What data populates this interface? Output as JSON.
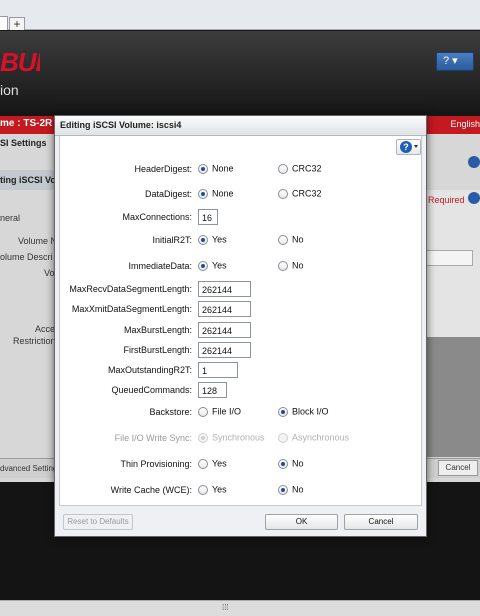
{
  "browser": {
    "new_tab_label": "+"
  },
  "background": {
    "logo_text": "BUFFALO",
    "app_subtitle": "ion",
    "help_button": "? ▾",
    "red_bar_title": "me : TS-2R",
    "red_bar_right": "English",
    "nav1": "SI Settings",
    "nav2": "ting iSCSI Volu",
    "labels": [
      "neral",
      "Volume N",
      "olume Descri",
      "Vo",
      "Acce",
      "Restriction"
    ],
    "required_text": "Required",
    "bottom_left": "dvanced Setting",
    "bottom_right": "Cancel"
  },
  "modal": {
    "title": "Editing iSCSI Volume: iscsi4",
    "fields": {
      "header_digest": {
        "label": "HeaderDigest:",
        "option1": "None",
        "option2": "CRC32"
      },
      "data_digest": {
        "label": "DataDigest:",
        "option1": "None",
        "option2": "CRC32"
      },
      "max_connections": {
        "label": "MaxConnections:",
        "value": "16"
      },
      "initial_r2t": {
        "label": "InitialR2T:",
        "option1": "Yes",
        "option2": "No"
      },
      "immediate_data": {
        "label": "ImmediateData:",
        "option1": "Yes",
        "option2": "No"
      },
      "max_recv": {
        "label": "MaxRecvDataSegmentLength:",
        "value": "262144"
      },
      "max_xmit": {
        "label": "MaxXmitDataSegmentLength:",
        "value": "262144"
      },
      "max_burst": {
        "label": "MaxBurstLength:",
        "value": "262144"
      },
      "first_burst": {
        "label": "FirstBurstLength:",
        "value": "262144"
      },
      "max_outstanding": {
        "label": "MaxOutstandingR2T:",
        "value": "1"
      },
      "queued_commands": {
        "label": "QueuedCommands:",
        "value": "128"
      },
      "backstore": {
        "label": "Backstore:",
        "option1": "File I/O",
        "option2": "Block I/O"
      },
      "file_io_sync": {
        "label": "File I/O Write Sync:",
        "option1": "Synchronous",
        "option2": "Asynchronous"
      },
      "thin_provisioning": {
        "label": "Thin Provisioning:",
        "option1": "Yes",
        "option2": "No"
      },
      "write_cache": {
        "label": "Write Cache (WCE):",
        "option1": "Yes",
        "option2": "No"
      }
    },
    "buttons": {
      "reset": "Reset to Defaults",
      "ok": "OK",
      "cancel": "Cancel"
    }
  }
}
